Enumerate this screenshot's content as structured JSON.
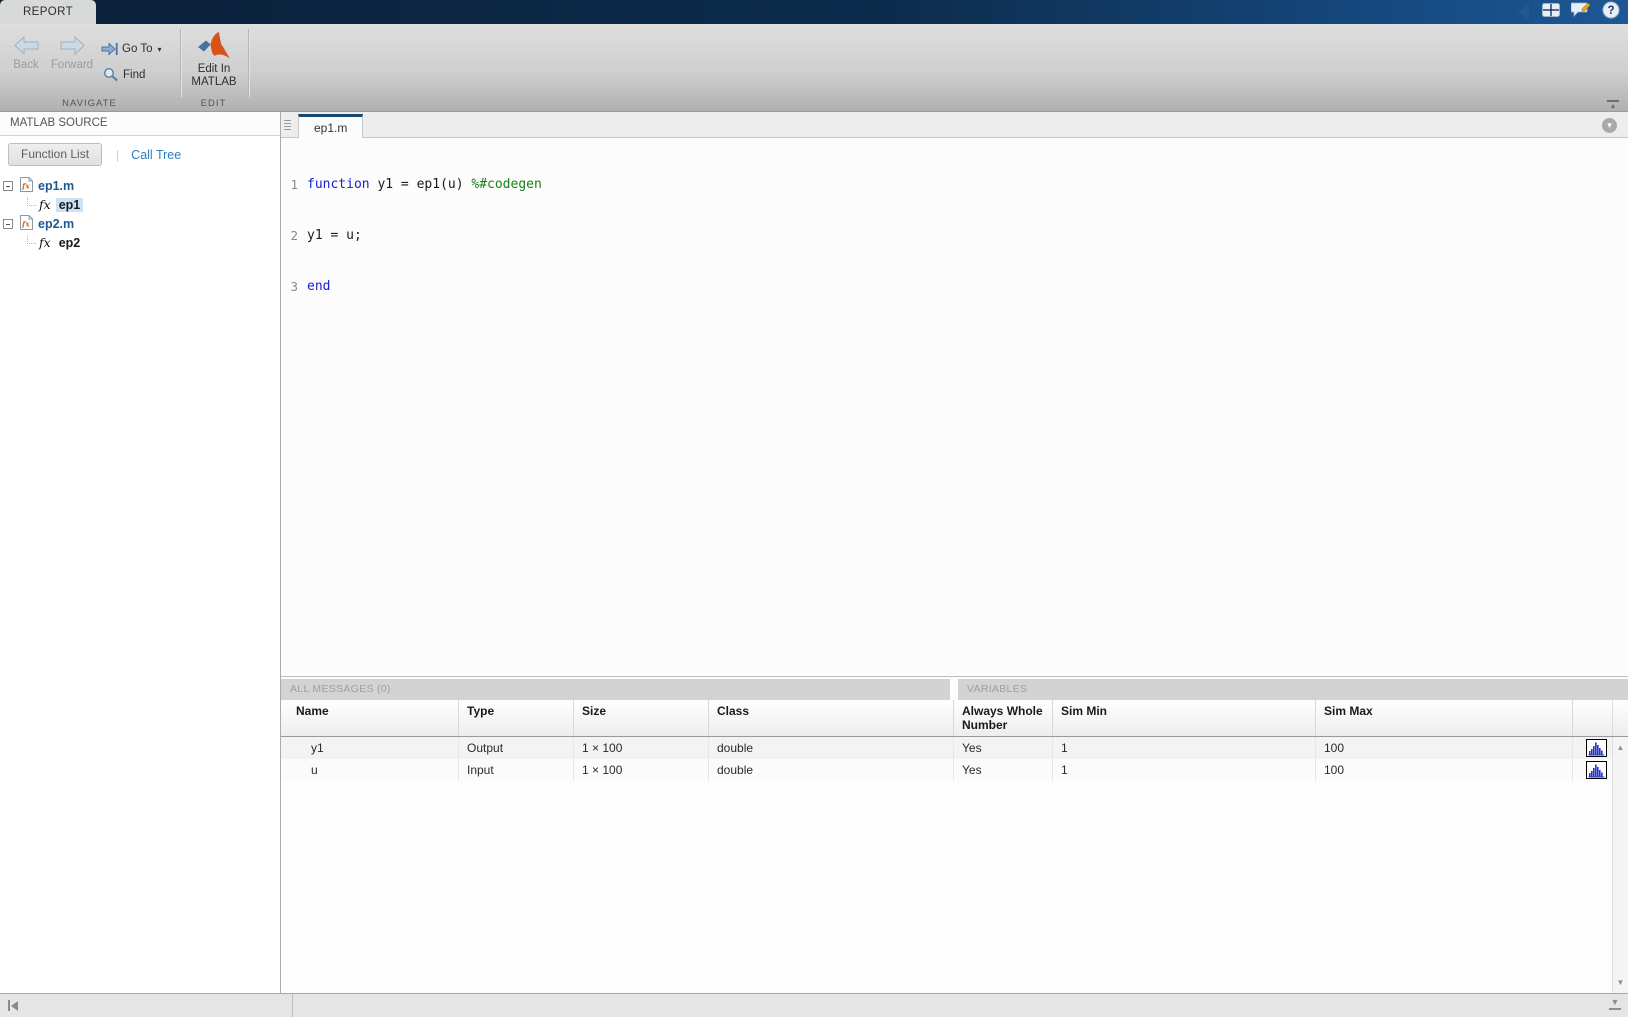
{
  "titlebar": {
    "report_tab": "REPORT"
  },
  "toolbar": {
    "back_label": "Back",
    "forward_label": "Forward",
    "goto_label": "Go To",
    "find_label": "Find",
    "edit_in_matlab_line1": "Edit In",
    "edit_in_matlab_line2": "MATLAB",
    "sections": {
      "navigate": "NAVIGATE",
      "edit": "EDIT"
    }
  },
  "sidebar": {
    "header": "MATLAB SOURCE",
    "tabs": {
      "function_list": "Function List",
      "call_tree": "Call Tree",
      "separator": "|"
    },
    "tree": [
      {
        "file": "ep1.m",
        "children": [
          {
            "label": "ep1",
            "selected": true
          }
        ]
      },
      {
        "file": "ep2.m",
        "children": [
          {
            "label": "ep2",
            "selected": false
          }
        ]
      }
    ],
    "fx_glyph": "fx"
  },
  "editor": {
    "tab": "ep1.m",
    "lines": [
      {
        "num": "1",
        "segments": [
          {
            "text": "function",
            "cls": "kw"
          },
          {
            "text": " y1 = ep1(u) ",
            "cls": "plain"
          },
          {
            "text": "%#codegen",
            "cls": "comment"
          }
        ]
      },
      {
        "num": "2",
        "segments": [
          {
            "text": "y1 = u;",
            "cls": "plain"
          }
        ]
      },
      {
        "num": "3",
        "segments": [
          {
            "text": "end",
            "cls": "kw"
          }
        ]
      }
    ]
  },
  "messages_panel": {
    "header": "ALL MESSAGES (0)"
  },
  "variables_panel": {
    "header": "VARIABLES",
    "columns": [
      "Name",
      "Type",
      "Size",
      "Class",
      "Always Whole Number",
      "Sim Min",
      "Sim Max"
    ],
    "rows": [
      {
        "name": "y1",
        "type": "Output",
        "size": "1 × 100",
        "class": "double",
        "always_whole_number": "Yes",
        "sim_min": "1",
        "sim_max": "100"
      },
      {
        "name": "u",
        "type": "Input",
        "size": "1 × 100",
        "class": "double",
        "always_whole_number": "Yes",
        "sim_min": "1",
        "sim_max": "100"
      }
    ]
  },
  "icons": {
    "goto_caret": "▾",
    "tab_overflow": "▾",
    "collapse_toolstrip": "▲",
    "scroll_up": "▲",
    "scroll_down": "▼"
  },
  "colors": {
    "title_navy": "#0d2c4d",
    "active_tab_accent": "#16476e",
    "link_blue": "#2d7dc1",
    "keyword_blue": "#1321d1",
    "comment_green": "#178117",
    "selection_blue": "#cbe3f7",
    "histogram_blue": "#2233cc"
  }
}
